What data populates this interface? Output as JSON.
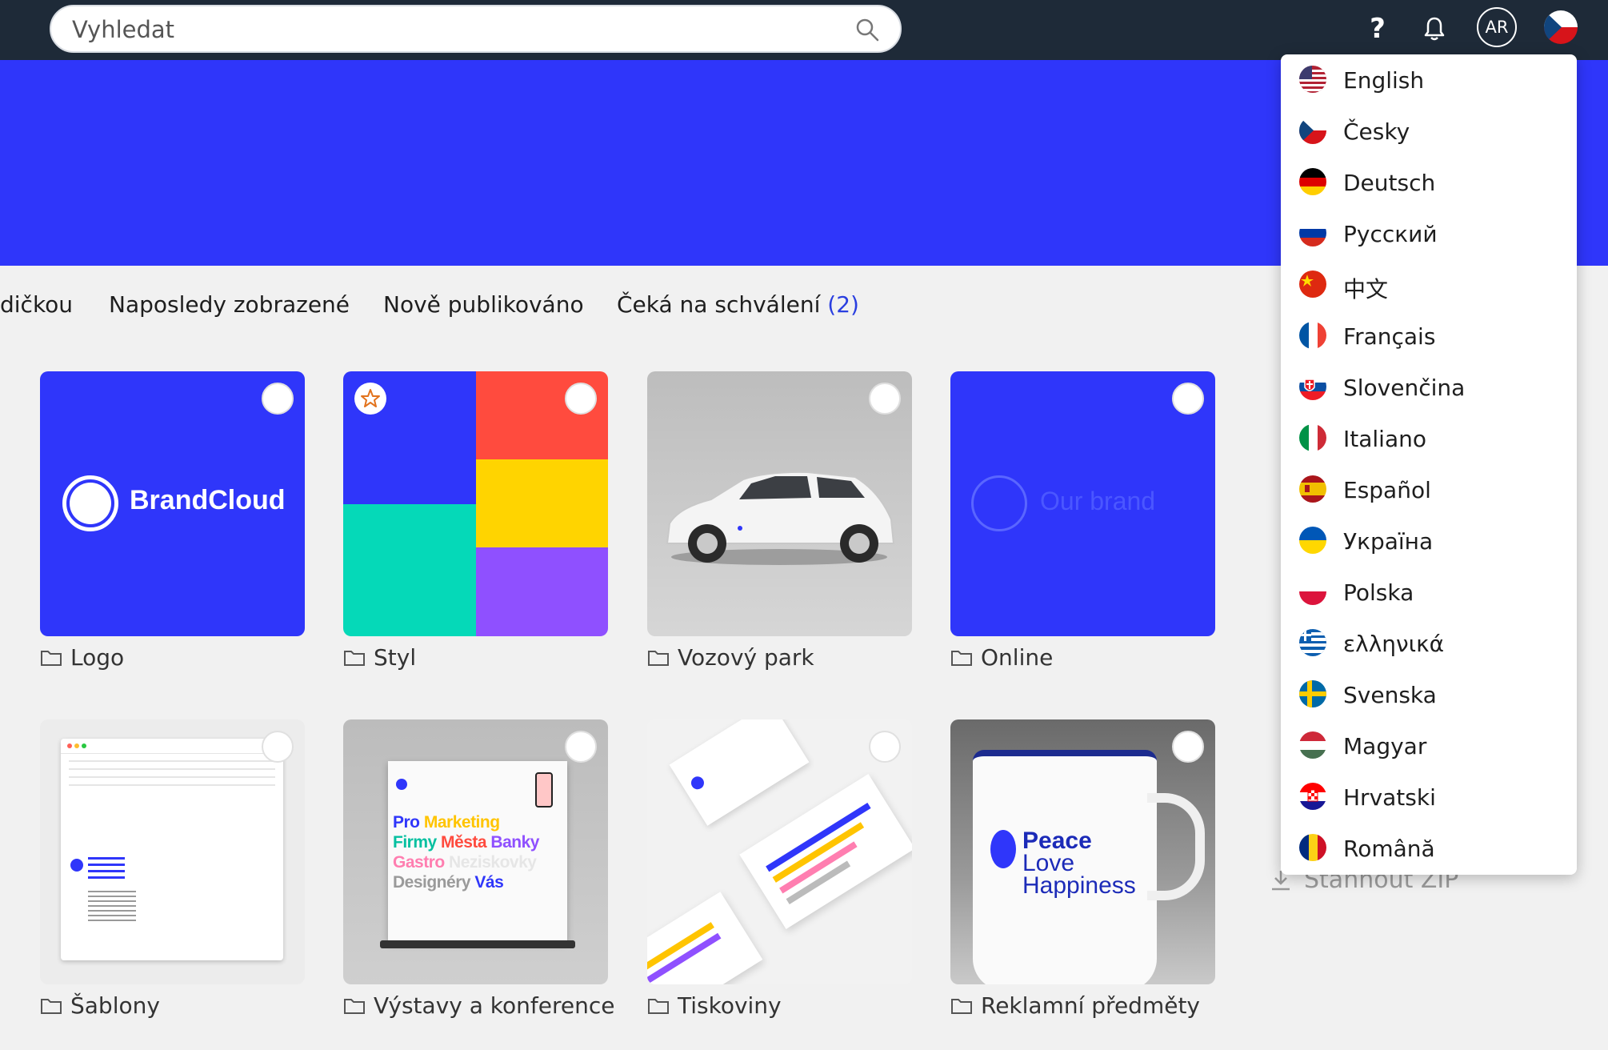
{
  "search": {
    "placeholder": "Vyhledat"
  },
  "header": {
    "help_label": "?",
    "avatar_initials": "AR"
  },
  "tabs": [
    {
      "label": "dičkou"
    },
    {
      "label": "Naposledy zobrazené"
    },
    {
      "label": "Nově publikováno"
    },
    {
      "label": "Čeká na schválení",
      "count": "(2)"
    }
  ],
  "folders": [
    {
      "name": "Logo",
      "thumb_text": "BrandCloud"
    },
    {
      "name": "Styl"
    },
    {
      "name": "Vozový park"
    },
    {
      "name": "Online",
      "thumb_text": "Our brand"
    },
    {
      "name": "Šablony"
    },
    {
      "name": "Výstavy a konference",
      "thumb_text": [
        "Pro",
        "Marketing",
        "Firmy",
        "Města",
        "Banky",
        "Gastro",
        "Neziskovky",
        "Designéry",
        "Vás"
      ]
    },
    {
      "name": "Tiskoviny"
    },
    {
      "name": "Reklamní předměty",
      "thumb_text": [
        "Peace",
        "Love",
        "Happiness"
      ]
    }
  ],
  "languages": [
    {
      "label": "English",
      "flag": "us"
    },
    {
      "label": "Česky",
      "flag": "cz"
    },
    {
      "label": "Deutsch",
      "flag": "de"
    },
    {
      "label": "Русский",
      "flag": "ru"
    },
    {
      "label": "中文",
      "flag": "cn"
    },
    {
      "label": "Français",
      "flag": "fr"
    },
    {
      "label": "Slovenčina",
      "flag": "sk"
    },
    {
      "label": "Italiano",
      "flag": "it"
    },
    {
      "label": "Español",
      "flag": "es"
    },
    {
      "label": "Україна",
      "flag": "ua"
    },
    {
      "label": "Polska",
      "flag": "pl"
    },
    {
      "label": "ελληνικά",
      "flag": "gr"
    },
    {
      "label": "Svenska",
      "flag": "se"
    },
    {
      "label": "Magyar",
      "flag": "hu"
    },
    {
      "label": "Hrvatski",
      "flag": "hr"
    },
    {
      "label": "Română",
      "flag": "ro"
    }
  ],
  "sidebar": {
    "download_zip_label": "Stáhnout ZIP"
  },
  "colors": {
    "topbar": "#1e2a38",
    "hero": "#2f36fa",
    "accent": "#2a3fe0"
  }
}
